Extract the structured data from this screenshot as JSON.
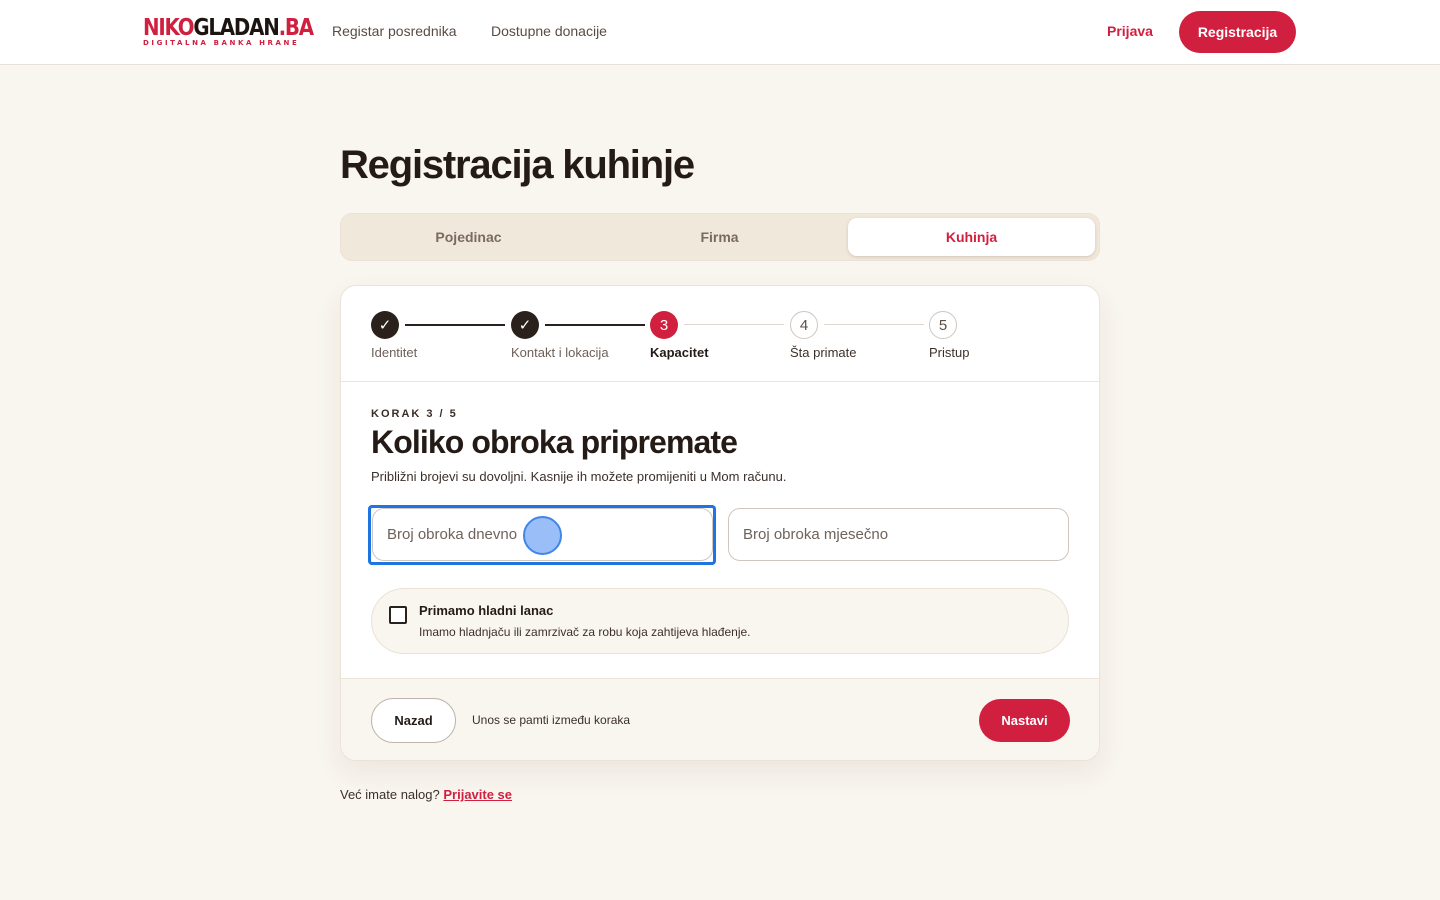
{
  "header": {
    "logo_top_parts": [
      "NIKO",
      "GLADAN",
      ".BA"
    ],
    "logo_sub": "DIGITALNA BANKA HRANE",
    "nav": [
      "Registar posrednika",
      "Dostupne donacije"
    ],
    "login_label": "Prijava",
    "register_label": "Registracija"
  },
  "page": {
    "title": "Registracija kuhinje"
  },
  "type_tabs": {
    "items": [
      "Pojedinac",
      "Firma",
      "Kuhinja"
    ],
    "active": "Kuhinja"
  },
  "stepper": {
    "steps": [
      {
        "number": "1",
        "label": "Identitet",
        "state": "done"
      },
      {
        "number": "2",
        "label": "Kontakt i lokacija",
        "state": "done"
      },
      {
        "number": "3",
        "label": "Kapacitet",
        "state": "current"
      },
      {
        "number": "4",
        "label": "Šta primate",
        "state": "future"
      },
      {
        "number": "5",
        "label": "Pristup",
        "state": "future"
      }
    ],
    "check_glyph": "✓"
  },
  "form": {
    "kicker": "KORAK 3 / 5",
    "title": "Koliko obroka pripremate",
    "subtitle": "Približni brojevi su dovoljni. Kasnije ih možete promijeniti u Mom računu.",
    "daily_placeholder": "Broj obroka dnevno",
    "daily_value": "",
    "monthly_placeholder": "Broj obroka mjesečno",
    "monthly_value": "",
    "cold_chain": {
      "checked": false,
      "title": "Primamo hladni lanac",
      "description": "Imamo hladnjaču ili zamrzivač za robu koja zahtijeva hlađenje."
    }
  },
  "footer": {
    "back_label": "Nazad",
    "note": "Unos se pamti između koraka",
    "next_label": "Nastavi"
  },
  "bottom": {
    "question": "Već imate nalog?",
    "link": "Prijavite se"
  },
  "colors": {
    "brand_red": "#d11f3f",
    "dark": "#2b211c",
    "background": "#f9f5ef",
    "focus_blue": "#1e74e0"
  }
}
